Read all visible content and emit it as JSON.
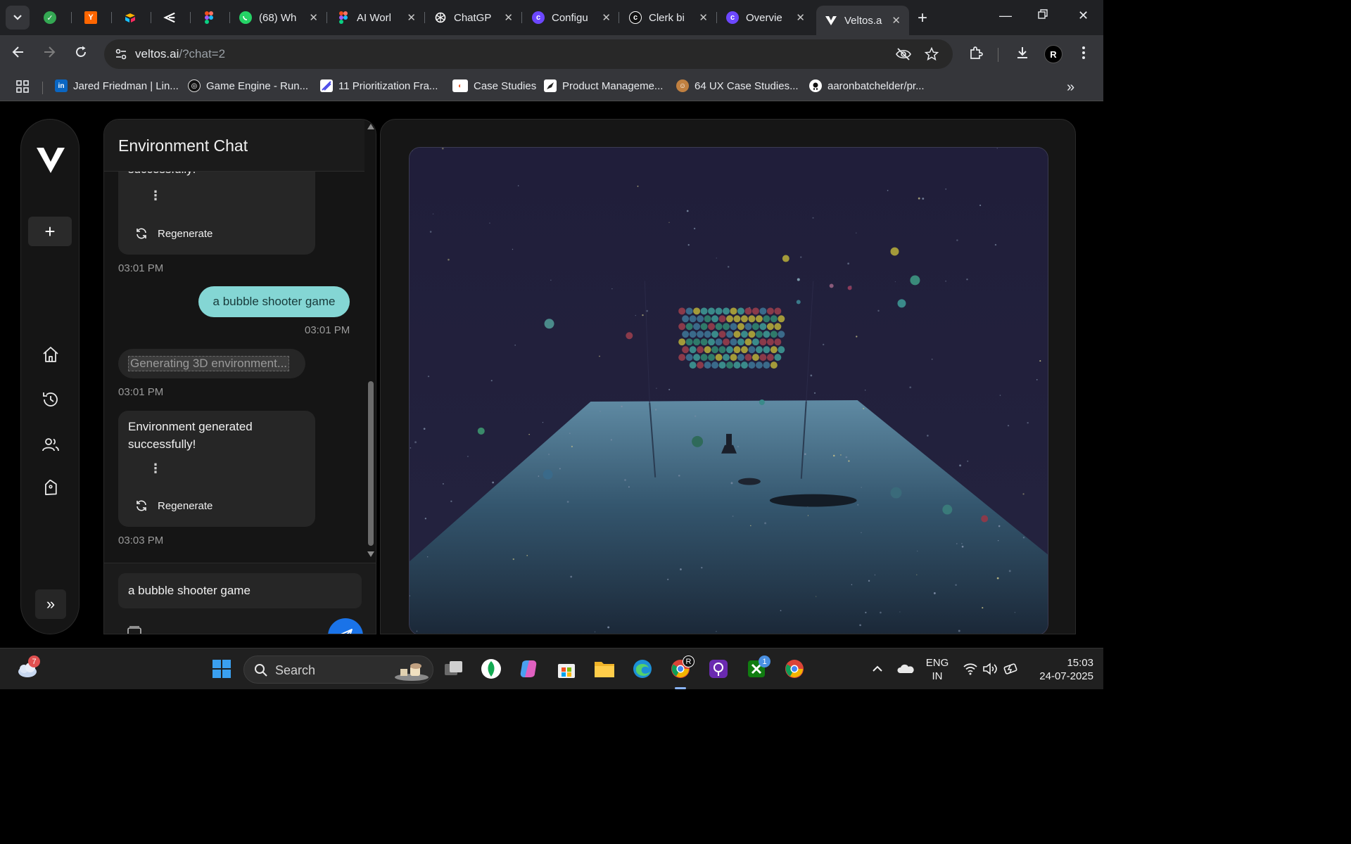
{
  "browser": {
    "tabs": [
      {
        "title": "",
        "favicon": "green-check-icon",
        "color": "#34a853"
      },
      {
        "title": "",
        "favicon": "y-icon",
        "color": "#ff6600"
      },
      {
        "title": "",
        "favicon": "airtable-icon",
        "color": "#fcb400"
      },
      {
        "title": "",
        "favicon": "arrow-logo-icon",
        "color": "#ffffff"
      },
      {
        "title": "",
        "favicon": "figma-icon",
        "color": "#a259ff"
      },
      {
        "title": "(68) Wh",
        "favicon": "whatsapp-icon",
        "color": "#25d366"
      },
      {
        "title": "AI Worl",
        "favicon": "figma-icon",
        "color": "#a259ff"
      },
      {
        "title": "ChatGP",
        "favicon": "openai-icon",
        "color": "#ffffff"
      },
      {
        "title": "Configu",
        "favicon": "clerk-icon",
        "color": "#6c47ff"
      },
      {
        "title": "Clerk bi",
        "favicon": "clerk-icon",
        "color": "#ffffff"
      },
      {
        "title": "Overvie",
        "favicon": "clerk-icon",
        "color": "#6c47ff"
      },
      {
        "title": "Veltos.a",
        "favicon": "veltos-icon",
        "color": "#ffffff"
      }
    ],
    "url_host": "veltos.ai",
    "url_path": "/?chat=2",
    "bookmarks": [
      {
        "label": "Jared Friedman | Lin...",
        "icon": "linkedin-icon",
        "color": "#0a66c2"
      },
      {
        "label": "Game Engine - Run...",
        "icon": "runtime-icon",
        "color": "#111111"
      },
      {
        "label": "11 Prioritization Fra...",
        "icon": "pen-icon",
        "color": "#4a4ae8"
      },
      {
        "label": "Case Studies",
        "icon": "case-studies-icon",
        "color": "#e85a2a"
      },
      {
        "label": "Product Manageme...",
        "icon": "rocket-icon",
        "color": "#ffffff"
      },
      {
        "label": "64 UX Case Studies...",
        "icon": "people-icon",
        "color": "#c08040"
      },
      {
        "label": "aaronbatchelder/pr...",
        "icon": "github-icon",
        "color": "#ffffff"
      }
    ],
    "profile_initial": "R"
  },
  "chat": {
    "title": "Environment Chat",
    "messages": {
      "prev_ai_tail": "successfully!",
      "prev_regen": "Regenerate",
      "prev_time": "03:01 PM",
      "user_msg": "a bubble shooter game",
      "user_time": "03:01 PM",
      "generating": "Generating 3D environment...",
      "generating_time": "03:01 PM",
      "ai_msg": "Environment generated successfully!",
      "ai_regen": "Regenerate",
      "ai_time": "03:03 PM"
    },
    "input_value": "a bubble shooter game"
  },
  "taskbar": {
    "weather_badge": "7",
    "search_label": "Search",
    "xbox_badge": "1",
    "lang_line1": "ENG",
    "lang_line2": "IN",
    "time": "15:03",
    "date": "24-07-2025"
  }
}
